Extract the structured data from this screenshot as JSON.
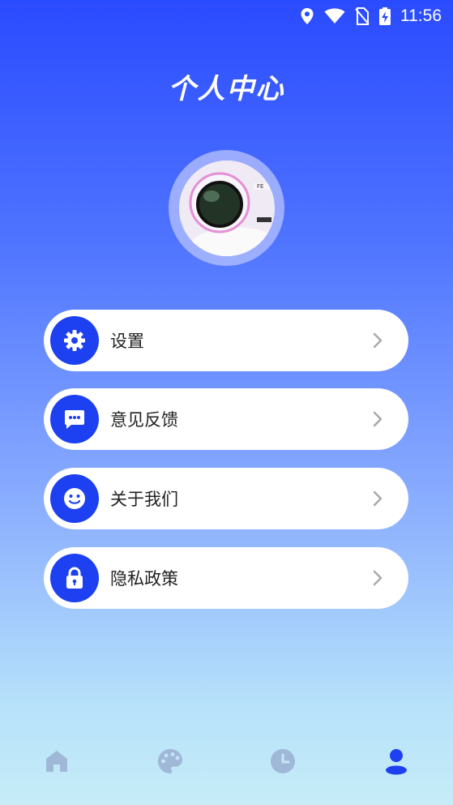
{
  "status_bar": {
    "time": "11:56"
  },
  "header": {
    "title": "个人中心"
  },
  "menu": {
    "items": [
      {
        "label": "设置"
      },
      {
        "label": "意见反馈"
      },
      {
        "label": "关于我们"
      },
      {
        "label": "隐私政策"
      }
    ]
  },
  "colors": {
    "accent": "#1d40f0",
    "inactive_tab": "#9fb8d8"
  },
  "tabbar": {
    "tabs": [
      "home-icon",
      "palette-icon",
      "clock-icon",
      "person-icon"
    ],
    "active_index": 3
  }
}
